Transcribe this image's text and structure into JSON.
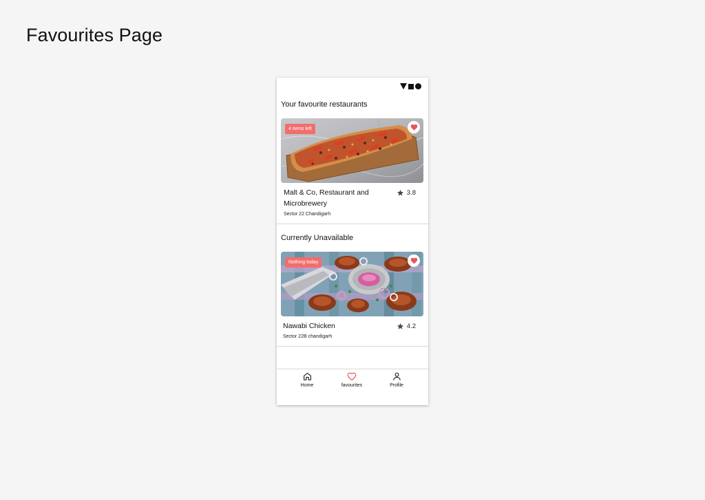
{
  "page": {
    "heading": "Favourites Page"
  },
  "sections": {
    "favourites_title": "Your favourite restaurants",
    "unavailable_title": "Currently Unavailable"
  },
  "cards": [
    {
      "badge": "4 items left",
      "name": "Malt & Co, Restaurant and Microbrewery",
      "rating": "3.8",
      "location": "Sector 22 Chandigarh"
    },
    {
      "badge": "Nothing today",
      "name": "Nawabi Chicken",
      "rating": "4.2",
      "location": "Sector 22B chandigarh"
    }
  ],
  "nav": {
    "home": "Home",
    "favourites": "favourites",
    "profile": "Profile"
  },
  "colors": {
    "accent": "#f26d6d",
    "heart": "#e8545a",
    "star": "#3d4a5c"
  },
  "icons": [
    "signal-icon",
    "battery-icon",
    "heart-icon",
    "star-icon",
    "home-icon",
    "profile-icon"
  ]
}
